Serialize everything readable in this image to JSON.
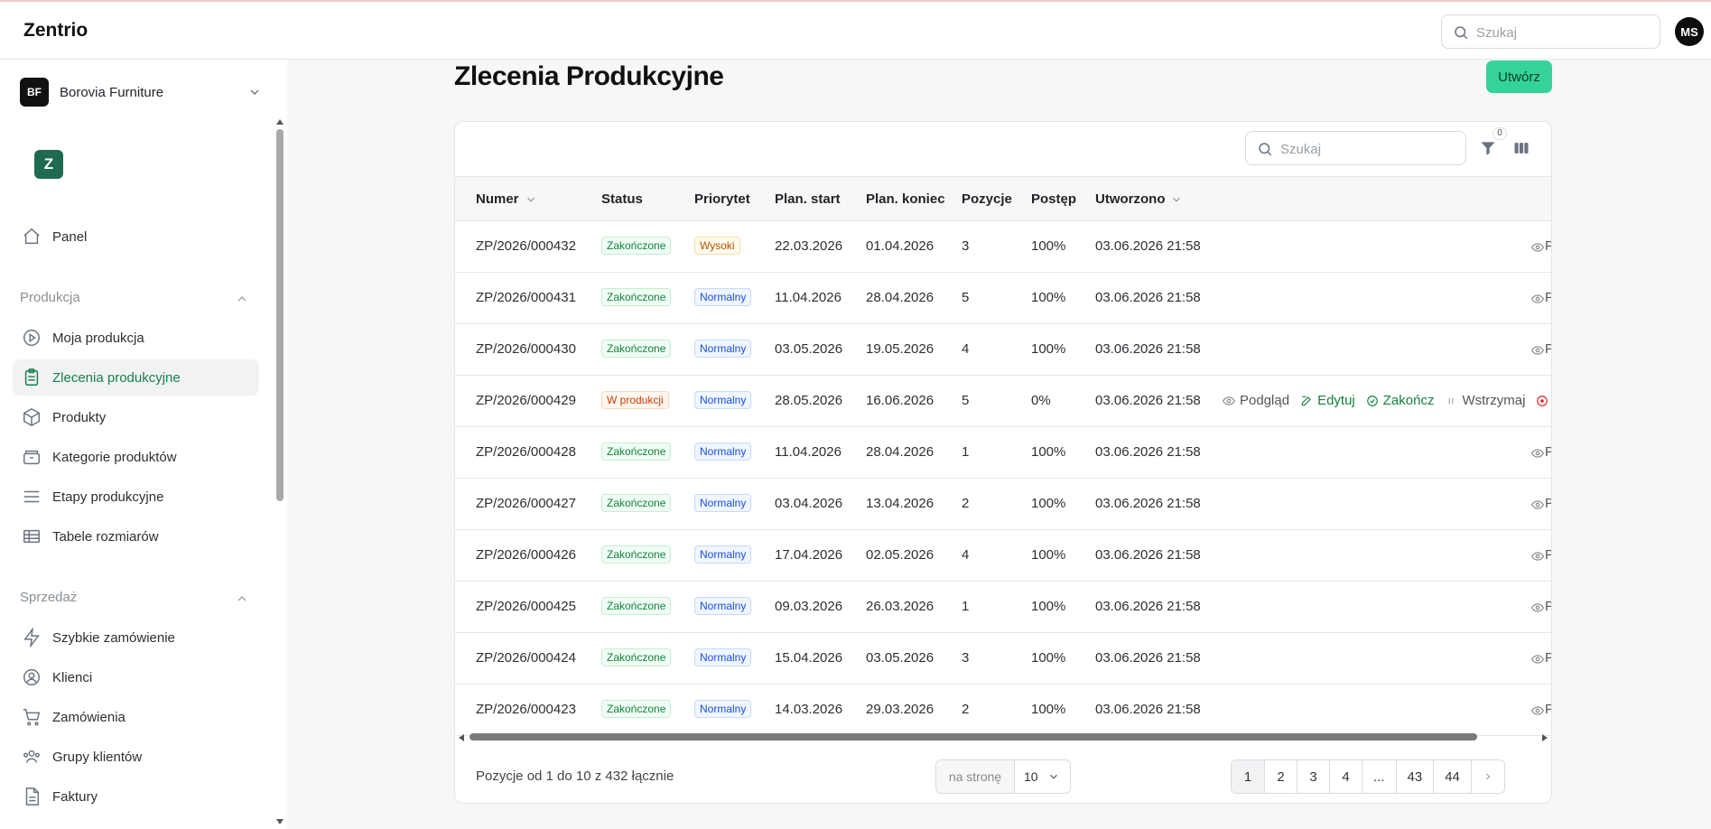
{
  "app": {
    "brand": "Zentrio"
  },
  "topbar": {
    "search_placeholder": "Szukaj",
    "avatar": "MS"
  },
  "org": {
    "logo": "BF",
    "name": "Borovia Furniture"
  },
  "module_logo": "Z",
  "nav": {
    "panel": "Panel",
    "production_section": "Produkcja",
    "production_items": [
      "Moja produkcja",
      "Zlecenia produkcyjne",
      "Produkty",
      "Kategorie produktów",
      "Etapy produkcyjne",
      "Tabele rozmiarów"
    ],
    "sales_section": "Sprzedaż",
    "sales_items": [
      "Szybkie zamówienie",
      "Klienci",
      "Zamówienia",
      "Grupy klientów",
      "Faktury"
    ]
  },
  "page": {
    "title": "Zlecenia Produkcyjne",
    "create_label": "Utwórz"
  },
  "table": {
    "search_placeholder": "Szukaj",
    "filter_count": "0",
    "columns": [
      "Numer",
      "Status",
      "Priorytet",
      "Plan. start",
      "Plan. koniec",
      "Pozycje",
      "Postęp",
      "Utworzono"
    ],
    "rows": [
      {
        "number": "ZP/2026/000432",
        "status": "Zakończone",
        "priority": "Wysoki",
        "start": "22.03.2026",
        "end": "01.04.2026",
        "items": "3",
        "progress": "100%",
        "created": "03.06.2026 21:58"
      },
      {
        "number": "ZP/2026/000431",
        "status": "Zakończone",
        "priority": "Normalny",
        "start": "11.04.2026",
        "end": "28.04.2026",
        "items": "5",
        "progress": "100%",
        "created": "03.06.2026 21:58"
      },
      {
        "number": "ZP/2026/000430",
        "status": "Zakończone",
        "priority": "Normalny",
        "start": "03.05.2026",
        "end": "19.05.2026",
        "items": "4",
        "progress": "100%",
        "created": "03.06.2026 21:58"
      },
      {
        "number": "ZP/2026/000429",
        "status": "W produkcji",
        "priority": "Normalny",
        "start": "28.05.2026",
        "end": "16.06.2026",
        "items": "5",
        "progress": "0%",
        "created": "03.06.2026 21:58"
      },
      {
        "number": "ZP/2026/000428",
        "status": "Zakończone",
        "priority": "Normalny",
        "start": "11.04.2026",
        "end": "28.04.2026",
        "items": "1",
        "progress": "100%",
        "created": "03.06.2026 21:58"
      },
      {
        "number": "ZP/2026/000427",
        "status": "Zakończone",
        "priority": "Normalny",
        "start": "03.04.2026",
        "end": "13.04.2026",
        "items": "2",
        "progress": "100%",
        "created": "03.06.2026 21:58"
      },
      {
        "number": "ZP/2026/000426",
        "status": "Zakończone",
        "priority": "Normalny",
        "start": "17.04.2026",
        "end": "02.05.2026",
        "items": "4",
        "progress": "100%",
        "created": "03.06.2026 21:58"
      },
      {
        "number": "ZP/2026/000425",
        "status": "Zakończone",
        "priority": "Normalny",
        "start": "09.03.2026",
        "end": "26.03.2026",
        "items": "1",
        "progress": "100%",
        "created": "03.06.2026 21:58"
      },
      {
        "number": "ZP/2026/000424",
        "status": "Zakończone",
        "priority": "Normalny",
        "start": "15.04.2026",
        "end": "03.05.2026",
        "items": "3",
        "progress": "100%",
        "created": "03.06.2026 21:58"
      },
      {
        "number": "ZP/2026/000423",
        "status": "Zakończone",
        "priority": "Normalny",
        "start": "14.03.2026",
        "end": "29.03.2026",
        "items": "2",
        "progress": "100%",
        "created": "03.06.2026 21:58"
      }
    ],
    "truncated_action": "P",
    "hover_actions": {
      "view": "Podgląd",
      "edit": "Edytuj",
      "finish": "Zakończ",
      "pause": "Wstrzymaj"
    }
  },
  "footer": {
    "summary": "Pozycje od 1 do 10 z 432 łącznie",
    "per_page_label": "na stronę",
    "per_page_value": "10",
    "pages": [
      "1",
      "2",
      "3",
      "4",
      "...",
      "43",
      "44"
    ],
    "current_page": "1"
  },
  "colors": {
    "accent": "#34d399",
    "active_nav": "#1a7f4b",
    "module_logo": "#1f6b4f"
  }
}
